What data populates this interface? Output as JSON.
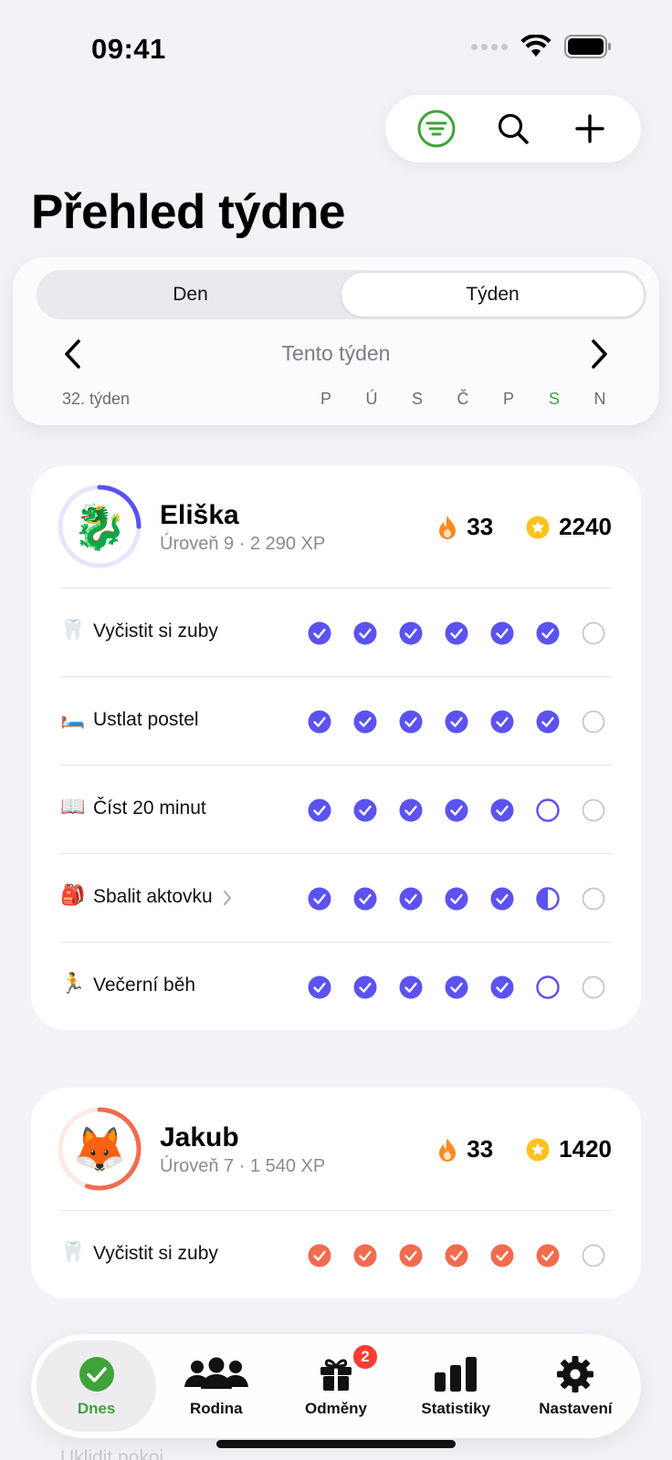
{
  "status": {
    "time": "09:41"
  },
  "header": {
    "title": "Přehled týdne",
    "actions": {
      "filter": "filter-icon",
      "search": "search-icon",
      "add": "plus-icon"
    }
  },
  "view_toggle": {
    "options": [
      "Den",
      "Týden"
    ],
    "selected": "Týden"
  },
  "week": {
    "label": "Tento týden",
    "number_label": "32. týden",
    "days": [
      "P",
      "Ú",
      "S",
      "Č",
      "P",
      "S",
      "N"
    ],
    "today_index": 5
  },
  "colors": {
    "accent_green": "#3fa33a",
    "purple": "#5b52f0",
    "coral": "#f26b4f",
    "flame": "#ff8a1e",
    "star": "#ffc21a"
  },
  "members": [
    {
      "name": "Eliška",
      "avatar": "🐉",
      "level": "Úroveň 9 · 2 290 XP",
      "streak": "33",
      "points": "2240",
      "ring_progress": 0.25,
      "color": "#5b52f0",
      "tasks": [
        {
          "emoji": "🦷",
          "label": "Vyčistit si zuby",
          "chevron": false,
          "days": [
            "done",
            "done",
            "done",
            "done",
            "done",
            "done",
            "empty"
          ]
        },
        {
          "emoji": "🛏️",
          "label": "Ustlat postel",
          "chevron": false,
          "days": [
            "done",
            "done",
            "done",
            "done",
            "done",
            "done",
            "empty"
          ]
        },
        {
          "emoji": "📖",
          "label": "Číst 20 minut",
          "chevron": false,
          "days": [
            "done",
            "done",
            "done",
            "done",
            "done",
            "open",
            "empty"
          ]
        },
        {
          "emoji": "🎒",
          "label": "Sbalit aktovku",
          "chevron": true,
          "days": [
            "done",
            "done",
            "done",
            "done",
            "done",
            "half",
            "empty"
          ]
        },
        {
          "emoji": "🏃",
          "label": "Večerní běh",
          "chevron": false,
          "days": [
            "done",
            "done",
            "done",
            "done",
            "done",
            "open",
            "empty"
          ]
        }
      ]
    },
    {
      "name": "Jakub",
      "avatar": "🦊",
      "level": "Úroveň 7 · 1 540 XP",
      "streak": "33",
      "points": "1420",
      "ring_progress": 0.55,
      "color": "#f26b4f",
      "tasks": [
        {
          "emoji": "🦷",
          "label": "Vyčistit si zuby",
          "chevron": false,
          "days": [
            "done",
            "done",
            "done",
            "done",
            "done",
            "done",
            "empty"
          ]
        }
      ]
    }
  ],
  "tabs": [
    {
      "label": "Dnes",
      "icon": "checkmark-circle-icon",
      "active": true
    },
    {
      "label": "Rodina",
      "icon": "people-icon",
      "active": false
    },
    {
      "label": "Odměny",
      "icon": "gift-icon",
      "active": false,
      "badge": "2"
    },
    {
      "label": "Statistiky",
      "icon": "bar-chart-icon",
      "active": false
    },
    {
      "label": "Nastavení",
      "icon": "gear-icon",
      "active": false
    }
  ],
  "peek_task": {
    "label": "Uklidit pokoj"
  }
}
